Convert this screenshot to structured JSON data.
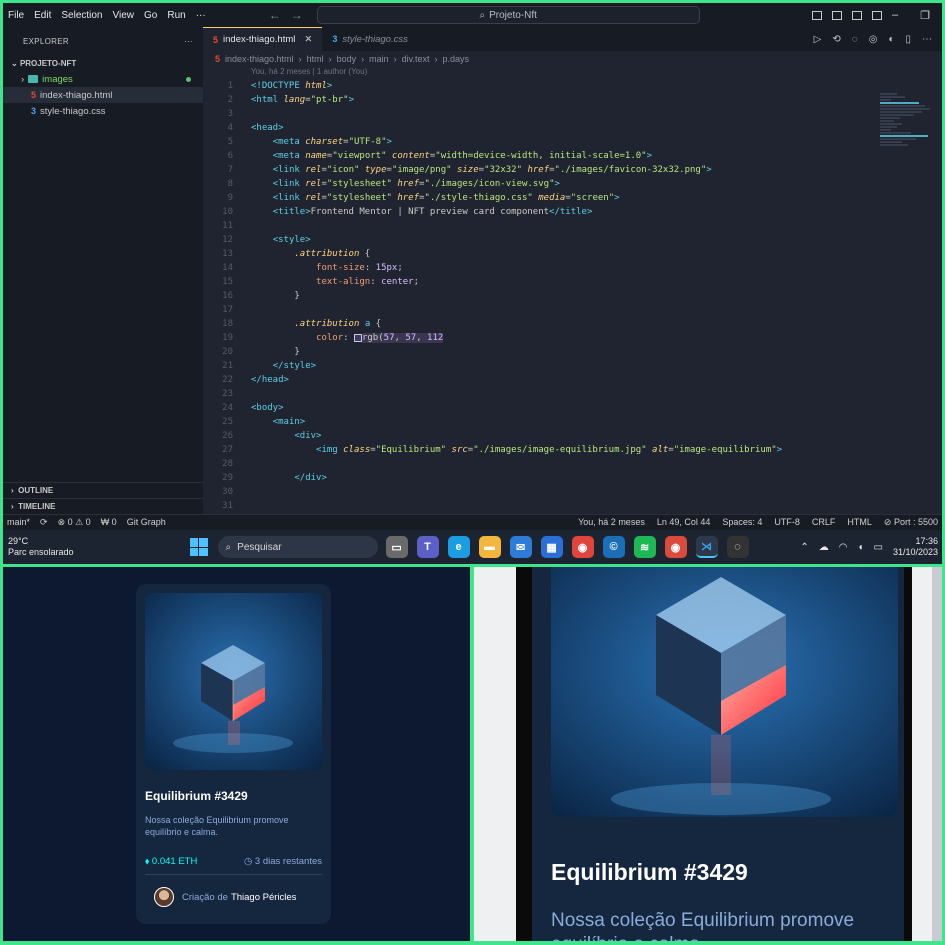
{
  "vscode": {
    "menu": [
      "File",
      "Edit",
      "Selection",
      "View",
      "Go",
      "Run",
      "···"
    ],
    "search": "Projeto-Nft",
    "explorer": {
      "title": "EXPLORER",
      "more": "···",
      "project": "PROJETO-NFT",
      "items": [
        {
          "label": "images",
          "kind": "folder"
        },
        {
          "label": "index-thiago.html",
          "kind": "html"
        },
        {
          "label": "style-thiago.css",
          "kind": "css"
        }
      ],
      "outline": "OUTLINE",
      "timeline": "TIMELINE"
    },
    "tabs": [
      {
        "label": "index-thiago.html",
        "close": "✕"
      },
      {
        "label": "style-thiago.css"
      }
    ],
    "breadcrumb": [
      "index-thiago.html",
      "html",
      "body",
      "main",
      "div.text",
      "p.days"
    ],
    "codelens": "You, há 2 meses | 1 author (You)",
    "code": [
      {
        "n": "1"
      },
      {
        "n": "2"
      },
      {
        "n": "3"
      },
      {
        "n": "4"
      },
      {
        "n": "5"
      },
      {
        "n": "6"
      },
      {
        "n": "7"
      },
      {
        "n": "8"
      },
      {
        "n": "9"
      },
      {
        "n": "10"
      },
      {
        "n": "11"
      },
      {
        "n": "12"
      },
      {
        "n": "13"
      },
      {
        "n": "14"
      },
      {
        "n": "15"
      },
      {
        "n": "16"
      },
      {
        "n": "17"
      },
      {
        "n": "18"
      },
      {
        "n": "19"
      },
      {
        "n": "20"
      },
      {
        "n": "21"
      },
      {
        "n": "22"
      },
      {
        "n": "23"
      },
      {
        "n": "24"
      },
      {
        "n": "25"
      },
      {
        "n": "26"
      },
      {
        "n": "27"
      },
      {
        "n": "28"
      },
      {
        "n": "29"
      },
      {
        "n": "30"
      },
      {
        "n": "31"
      }
    ],
    "status": {
      "branch": "main*",
      "sync": "⟳",
      "errors": "⊗ 0 ⚠ 0",
      "ports": "⁠₩ 0",
      "gitgraph": "Git Graph",
      "blame": "You, há 2 meses",
      "position": "Ln 49, Col 44",
      "spaces": "Spaces: 4",
      "encoding": "UTF-8",
      "eol": "CRLF",
      "lang": "HTML",
      "port": "⊘ Port : 5500"
    }
  },
  "taskbar": {
    "temp": "29°C",
    "weather": "Parc ensolarado",
    "search": "Pesquisar",
    "time": "17:36",
    "date": "31/10/2023"
  },
  "card": {
    "title": "Equilibrium #3429",
    "description": "Nossa coleção Equilibrium promove equilíbrio e calma.",
    "price": "0.041 ETH",
    "days": "3 dias restantes",
    "author_prefix": "Criação de",
    "author": "Thiago Péricles"
  },
  "mobile": {
    "title": "Equilibrium #3429",
    "description": "Nossa coleção Equilibrium promove equilíbrio e calma."
  },
  "colors": {
    "editor_bg": "#1f2430",
    "card_bg": "#15263f",
    "page_bg": "#0d1930",
    "cyan": "#00fff8",
    "soft_blue": "#8bacd9",
    "frame_green": "#3ee58a"
  }
}
